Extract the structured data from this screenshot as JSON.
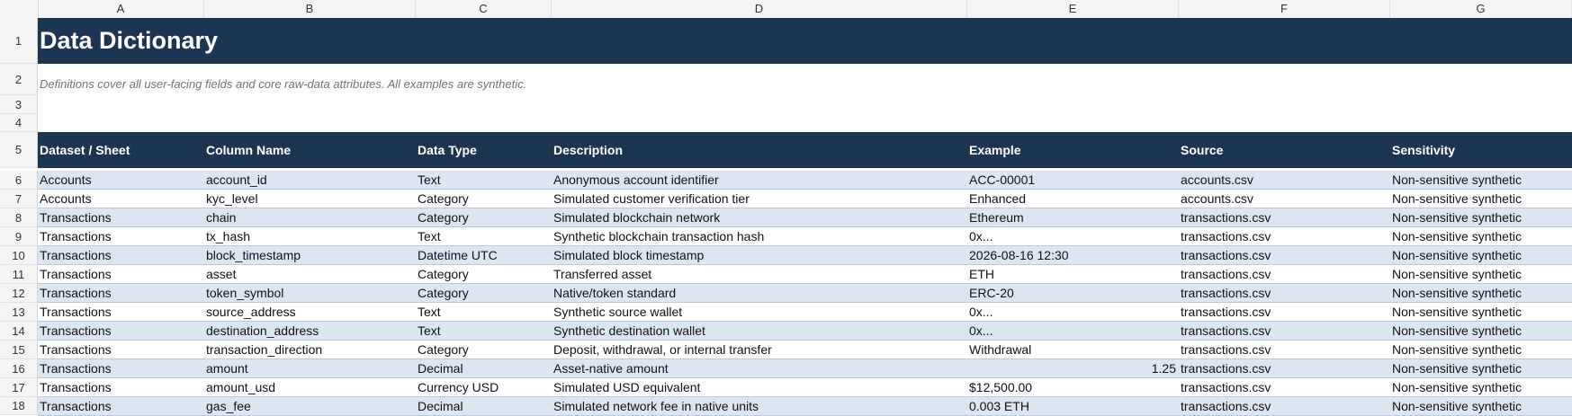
{
  "columns": [
    "A",
    "B",
    "C",
    "D",
    "E",
    "F",
    "G"
  ],
  "row_numbers": [
    "1",
    "2",
    "3",
    "4",
    "5",
    "6",
    "7",
    "8",
    "9",
    "10",
    "11",
    "12",
    "13",
    "14",
    "15",
    "16",
    "17",
    "18"
  ],
  "title": "Data Dictionary",
  "subtitle": "Definitions cover all user-facing fields and core raw-data attributes. All examples are synthetic.",
  "headers": [
    "Dataset / Sheet",
    "Column Name",
    "Data Type",
    "Description",
    "Example",
    "Source",
    "Sensitivity"
  ],
  "rows": [
    [
      "Accounts",
      "account_id",
      "Text",
      "Anonymous account identifier",
      "ACC-00001",
      "accounts.csv",
      "Non-sensitive synthetic"
    ],
    [
      "Accounts",
      "kyc_level",
      "Category",
      "Simulated customer verification tier",
      "Enhanced",
      "accounts.csv",
      "Non-sensitive synthetic"
    ],
    [
      "Transactions",
      "chain",
      "Category",
      "Simulated blockchain network",
      "Ethereum",
      "transactions.csv",
      "Non-sensitive synthetic"
    ],
    [
      "Transactions",
      "tx_hash",
      "Text",
      "Synthetic blockchain transaction hash",
      "0x...",
      "transactions.csv",
      "Non-sensitive synthetic"
    ],
    [
      "Transactions",
      "block_timestamp",
      "Datetime UTC",
      "Simulated block timestamp",
      "2026-08-16 12:30",
      "transactions.csv",
      "Non-sensitive synthetic"
    ],
    [
      "Transactions",
      "asset",
      "Category",
      "Transferred asset",
      "ETH",
      "transactions.csv",
      "Non-sensitive synthetic"
    ],
    [
      "Transactions",
      "token_symbol",
      "Category",
      "Native/token standard",
      "ERC-20",
      "transactions.csv",
      "Non-sensitive synthetic"
    ],
    [
      "Transactions",
      "source_address",
      "Text",
      "Synthetic source wallet",
      "0x...",
      "transactions.csv",
      "Non-sensitive synthetic"
    ],
    [
      "Transactions",
      "destination_address",
      "Text",
      "Synthetic destination wallet",
      "0x...",
      "transactions.csv",
      "Non-sensitive synthetic"
    ],
    [
      "Transactions",
      "transaction_direction",
      "Category",
      "Deposit, withdrawal, or internal transfer",
      "Withdrawal",
      "transactions.csv",
      "Non-sensitive synthetic"
    ],
    [
      "Transactions",
      "amount",
      "Decimal",
      "Asset-native amount",
      "1.25",
      "transactions.csv",
      "Non-sensitive synthetic"
    ],
    [
      "Transactions",
      "amount_usd",
      "Currency USD",
      "Simulated USD equivalent",
      "$12,500.00",
      "transactions.csv",
      "Non-sensitive synthetic"
    ],
    [
      "Transactions",
      "gas_fee",
      "Decimal",
      "Simulated network fee in native units",
      "0.003 ETH",
      "transactions.csv",
      "Non-sensitive synthetic"
    ]
  ]
}
